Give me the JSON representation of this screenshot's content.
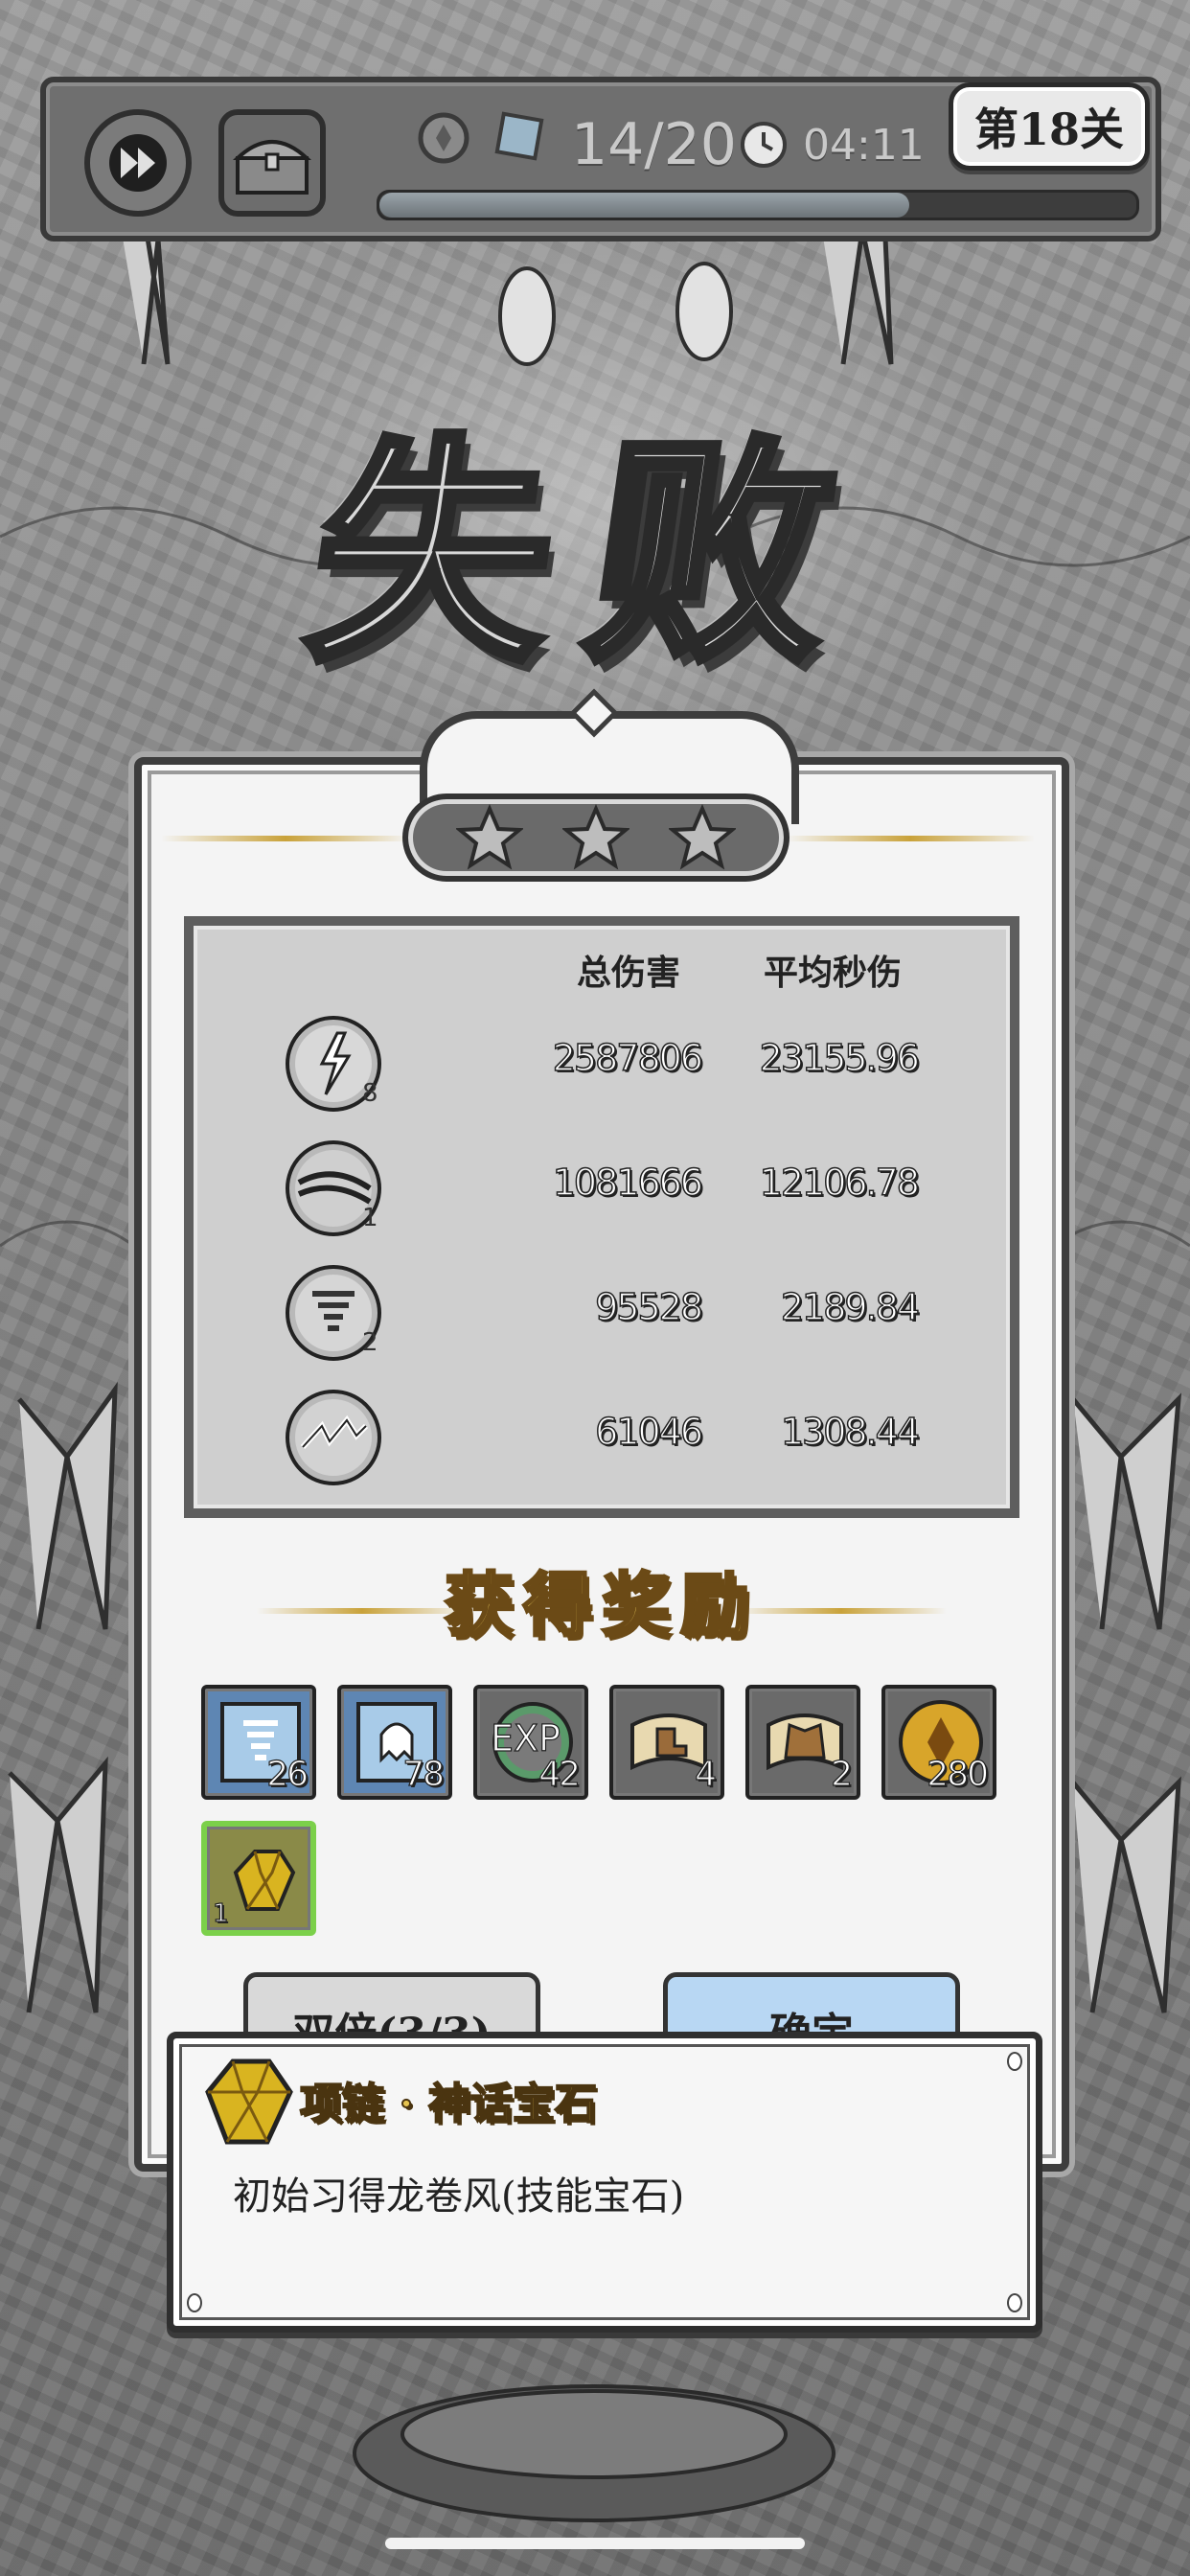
{
  "hud": {
    "wave": "14/20",
    "timer": "04:11",
    "stage": "第18关",
    "wave_progress": 0.7
  },
  "title": "失败",
  "stars": {
    "earned": 0,
    "total": 3
  },
  "damage_table": {
    "headers": {
      "total": "总伤害",
      "dps": "平均秒伤"
    },
    "rows": [
      {
        "icon": "lightning-orb-icon",
        "level": "8",
        "total": "2587806",
        "dps": "23155.96"
      },
      {
        "icon": "slash-orb-icon",
        "level": "1",
        "total": "1081666",
        "dps": "12106.78"
      },
      {
        "icon": "tornado-orb-icon",
        "level": "2",
        "total": "95528",
        "dps": "2189.84"
      },
      {
        "icon": "chain-lightning-orb-icon",
        "level": "",
        "total": "61046",
        "dps": "1308.44"
      }
    ]
  },
  "rewards": {
    "title": "获得奖励",
    "items": [
      {
        "icon": "tornado-gem-icon",
        "qty": "26"
      },
      {
        "icon": "ghost-gem-icon",
        "qty": "78"
      },
      {
        "icon": "exp-orb-icon",
        "label": "EXP",
        "qty": "42"
      },
      {
        "icon": "boots-scroll-icon",
        "qty": "4"
      },
      {
        "icon": "armor-scroll-icon",
        "qty": "2"
      },
      {
        "icon": "gold-coin-icon",
        "qty": "280"
      },
      {
        "icon": "mythic-gem-necklace-icon",
        "qty": "1"
      }
    ]
  },
  "buttons": {
    "double": "双倍(3/3)",
    "confirm": "确定"
  },
  "tooltip": {
    "title": "项链 · 神话宝石",
    "description": "初始习得龙卷风(技能宝石)"
  },
  "colors": {
    "gold": "#e6c450",
    "confirm_blue": "#b8d7f3",
    "selected_green": "#7bd04a"
  }
}
